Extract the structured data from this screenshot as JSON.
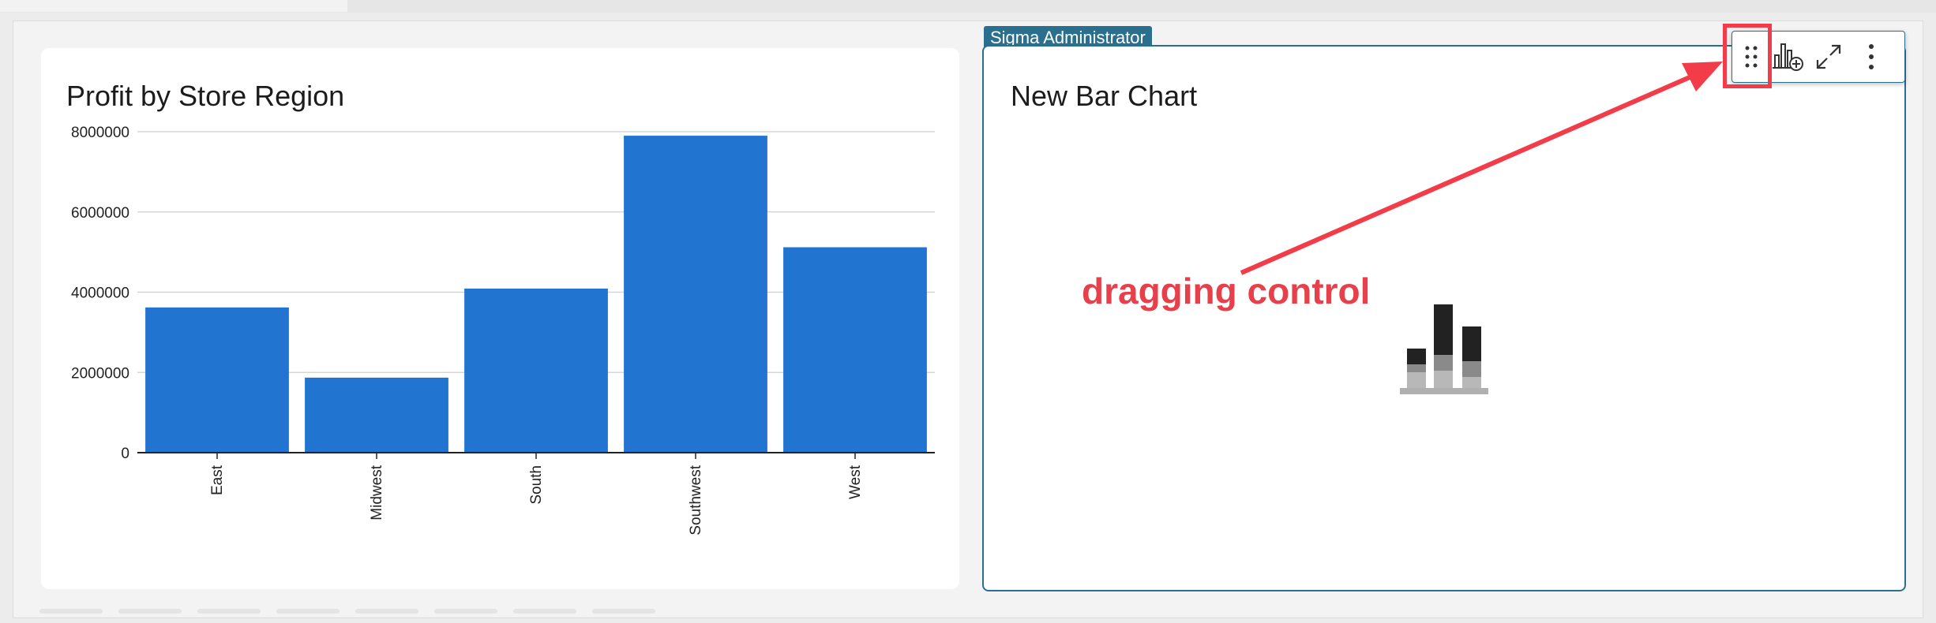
{
  "left_panel": {
    "title": "Profit by Store Region"
  },
  "right_panel": {
    "badge": "Sigma Administrator",
    "title": "New Bar Chart",
    "empty_state_icon": "stacked-bar-chart-placeholder-icon"
  },
  "toolbar": {
    "buttons": [
      {
        "name": "drag-handle",
        "icon": "drag-handle-icon"
      },
      {
        "name": "add-chart",
        "icon": "add-chart-icon"
      },
      {
        "name": "expand",
        "icon": "expand-icon"
      },
      {
        "name": "more-options",
        "icon": "more-vertical-icon"
      }
    ]
  },
  "annotation": {
    "text": "dragging control",
    "color": "#e8404b"
  },
  "colors": {
    "bar": "#2174d0",
    "accent": "#2a6f8e",
    "annotation": "#f23c4a"
  },
  "chart_data": {
    "type": "bar",
    "title": "Profit by Store Region",
    "categories": [
      "East",
      "Midwest",
      "South",
      "Southwest",
      "West"
    ],
    "values": [
      3620000,
      1870000,
      4090000,
      7900000,
      5120000
    ],
    "y_ticks": [
      "0",
      "2000000",
      "4000000",
      "6000000",
      "8000000"
    ],
    "ylim": [
      0,
      8000000
    ],
    "xlabel": "",
    "ylabel": "",
    "grid": true
  }
}
